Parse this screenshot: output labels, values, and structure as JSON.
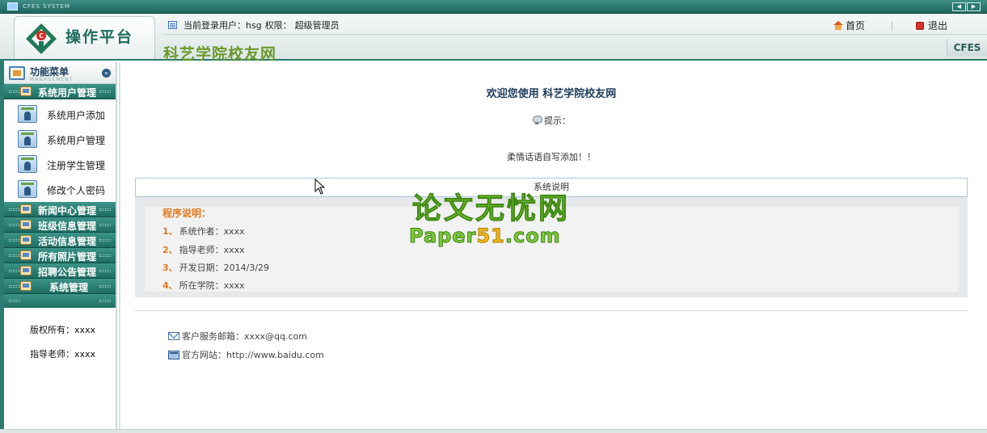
{
  "titlebar": {
    "system_label": "CFES SYSTEM"
  },
  "header": {
    "logo_text": "操作平台",
    "site_name": "科艺学院校友网",
    "user_prefix": "当前登录用户：",
    "username": "hsg",
    "role_prefix": "权限：",
    "role": "超级管理员",
    "home_label": "首页",
    "logout_label": "退出",
    "badge": "CFES"
  },
  "sidebar": {
    "menu_title": "功能菜单",
    "menu_subtitle": "MANAGEMENT",
    "groups": [
      {
        "label": "系统用户管理"
      },
      {
        "label": "新闻中心管理"
      },
      {
        "label": "班级信息管理"
      },
      {
        "label": "活动信息管理"
      },
      {
        "label": "所有照片管理"
      },
      {
        "label": "招聘公告管理"
      },
      {
        "label": "系统管理"
      }
    ],
    "items": [
      {
        "label": "系统用户添加"
      },
      {
        "label": "系统用户管理"
      },
      {
        "label": "注册学生管理"
      },
      {
        "label": "修改个人密码"
      }
    ],
    "copyright": "版权所有：xxxx",
    "advisor": "指导老师：xxxx"
  },
  "main": {
    "welcome": "欢迎您使用  科艺学院校友网",
    "tip_label": "提示：",
    "tip_message": "柔情话语自写添加！！",
    "panel_title": "系统说明",
    "program_title": "程序说明：",
    "info": [
      {
        "num": "1、",
        "text": "系统作者：xxxx"
      },
      {
        "num": "2、",
        "text": "指导老师：xxxx"
      },
      {
        "num": "3、",
        "text": "开发日期：2014/3/29"
      },
      {
        "num": "4、",
        "text": "所在学院：xxxx"
      }
    ],
    "email": "客户服务邮箱：xxxx@qq.com",
    "website": "官方网站：http://www.baidu.com"
  },
  "watermark": {
    "cn": "论文无忧网",
    "en_a": "Paper",
    "en_hl": "51",
    "en_b": ".com"
  },
  "colors": {
    "frame": "#2e7b71",
    "menu_group": "#1e6d63",
    "accent_orange": "#e07a1f",
    "site_name_green": "#6a9a2c"
  }
}
